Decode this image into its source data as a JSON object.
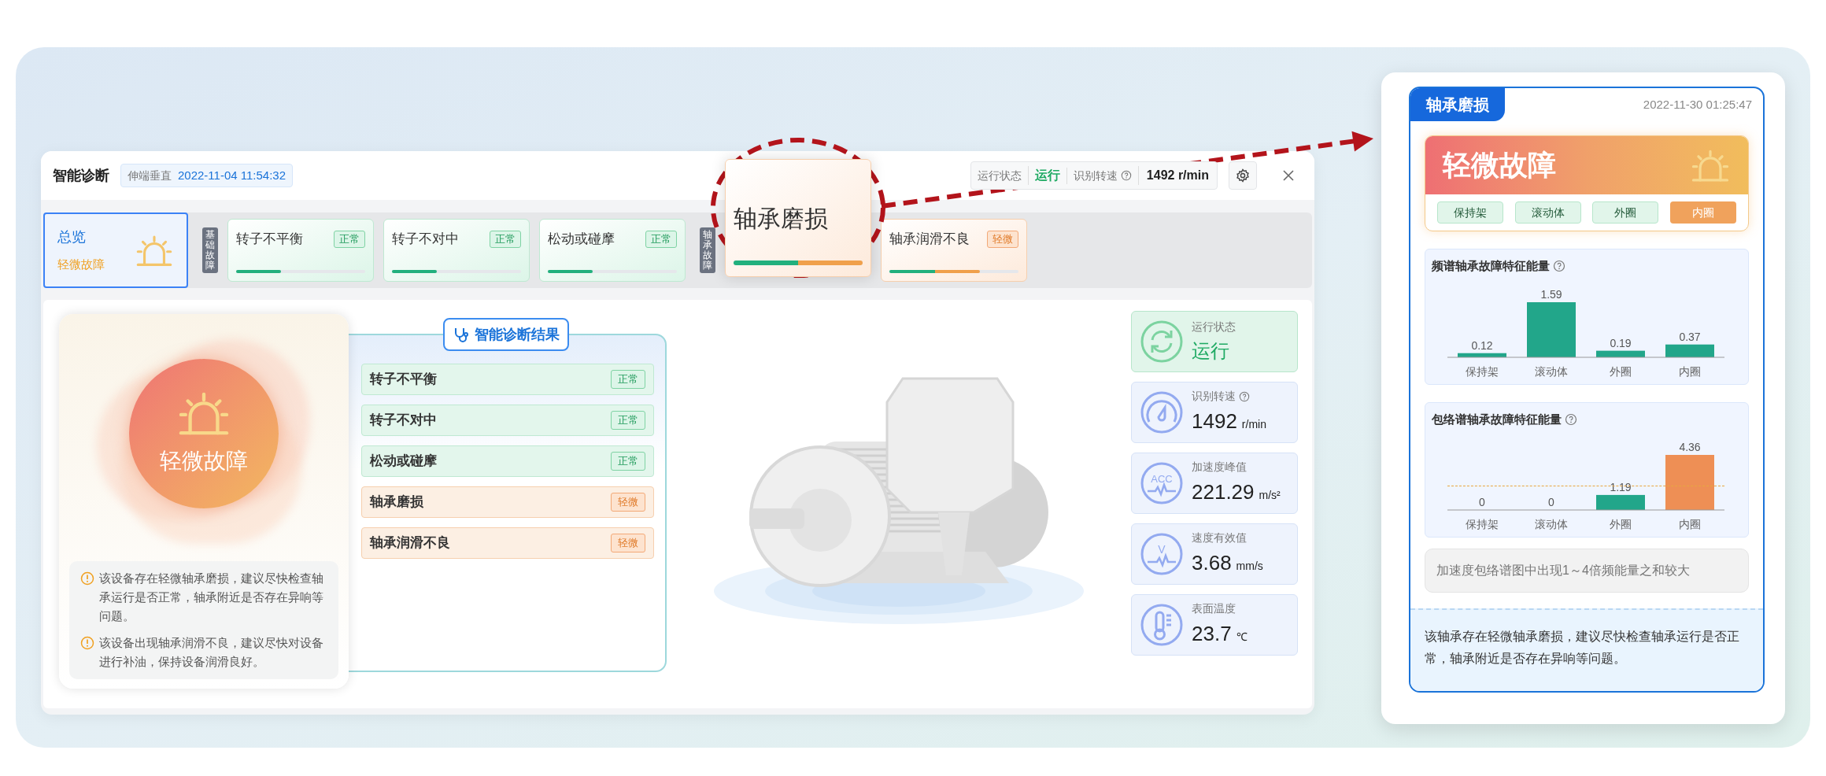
{
  "window": {
    "title": "智能诊断",
    "tag_label": "伸端垂直",
    "tag_time": "2022-11-04 11:54:32",
    "status_label": "运行状态",
    "status_value": "运行",
    "speed_label": "识别转速",
    "speed_value": "1492 r/min"
  },
  "overview": {
    "label": "总览",
    "status": "轻微故障",
    "selected": true
  },
  "groups": [
    {
      "label": "基础故障",
      "cards": [
        {
          "name": "转子不平衡",
          "badge": "正常",
          "warning": false,
          "level": 0.35,
          "magnified": false
        },
        {
          "name": "转子不对中",
          "badge": "正常",
          "warning": false,
          "level": 0.35,
          "magnified": false
        },
        {
          "name": "松动或碰摩",
          "badge": "正常",
          "warning": false,
          "level": 0.35,
          "magnified": false
        }
      ]
    },
    {
      "label": "轴承故障",
      "cards": [
        {
          "name": "轴承磨损",
          "warning": true,
          "level": 1,
          "magnified": true
        },
        {
          "name": "轴承润滑不良",
          "badge": "轻微",
          "warning": true,
          "level": 0.7,
          "magnified": false
        }
      ]
    }
  ],
  "summary": {
    "status": "轻微故障",
    "notes": [
      "该设备存在轻微轴承磨损，建议尽快检查轴承运行是否正常，轴承附近是否存在异响等问题。",
      "该设备出现轴承润滑不良，建议尽快对设备进行补油，保持设备润滑良好。"
    ]
  },
  "results": {
    "title": "智能诊断结果",
    "items": [
      {
        "name": "转子不平衡",
        "badge": "正常",
        "warning": false
      },
      {
        "name": "转子不对中",
        "badge": "正常",
        "warning": false
      },
      {
        "name": "松动或碰摩",
        "badge": "正常",
        "warning": false
      },
      {
        "name": "轴承磨损",
        "badge": "轻微",
        "warning": true
      },
      {
        "name": "轴承润滑不良",
        "badge": "轻微",
        "warning": true
      }
    ]
  },
  "metrics": [
    {
      "kind": "status",
      "label": "运行状态",
      "value": "运行",
      "help": false
    },
    {
      "kind": "speed",
      "label": "识别转速",
      "value": "1492",
      "unit": "r/min",
      "help": true
    },
    {
      "kind": "acc",
      "label": "加速度峰值",
      "value": "221.29",
      "unit": "m/s²",
      "icon_text": "ACC",
      "help": false
    },
    {
      "kind": "velocity",
      "label": "速度有效值",
      "value": "3.68",
      "unit": "mm/s",
      "icon_text": "V",
      "help": false
    },
    {
      "kind": "temp",
      "label": "表面温度",
      "value": "23.7",
      "unit": "℃",
      "help": false
    }
  ],
  "detail": {
    "tab": "轴承磨损",
    "time": "2022-11-30 01:25:47",
    "status": "轻微故障",
    "parts": [
      {
        "label": "保持架",
        "fault": false
      },
      {
        "label": "滚动体",
        "fault": false
      },
      {
        "label": "外圈",
        "fault": false
      },
      {
        "label": "内圈",
        "fault": true
      }
    ],
    "charts": [
      {
        "title": "频谱轴承故障特征能量",
        "threshold_line": false,
        "chart_data": {
          "type": "bar",
          "categories": [
            "保持架",
            "滚动体",
            "外圈",
            "内圈"
          ],
          "series": [
            {
              "color": "#22a68a",
              "values": [
                0.12,
                1.59,
                0.19,
                0.37
              ]
            }
          ],
          "ylim": [
            0,
            1.59
          ],
          "data_labels": true
        }
      },
      {
        "title": "包络谱轴承故障特征能量",
        "threshold_line": true,
        "chart_data": {
          "type": "bar",
          "categories": [
            "保持架",
            "滚动体",
            "外圈",
            "内圈"
          ],
          "series": [
            {
              "color": "#22a68a",
              "values": [
                0,
                0,
                1.19,
                null
              ]
            },
            {
              "color": "#ee8f55",
              "values": [
                null,
                null,
                null,
                4.36
              ]
            }
          ],
          "stacked": true,
          "ylim": [
            0,
            4.36
          ],
          "data_labels": true
        }
      }
    ],
    "finding": "加速度包络谱图中出现1～4倍频能量之和较大",
    "advice": "该轴承存在轻微轴承磨损，建议尽快检查轴承运行是否正常，轴承附近是否存在异响等问题。"
  }
}
